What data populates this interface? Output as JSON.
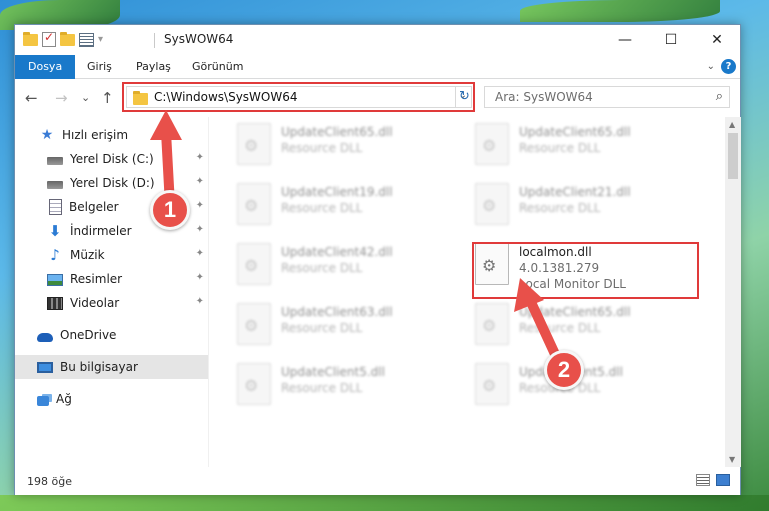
{
  "window": {
    "title": "SysWOW64",
    "controls": {
      "minimize": "—",
      "maximize": "☐",
      "close": "✕"
    }
  },
  "ribbon": {
    "tabs": [
      "Dosya",
      "Giriş",
      "Paylaş",
      "Görünüm"
    ],
    "expand_glyph": "⌄",
    "help_glyph": "?"
  },
  "nav": {
    "back": "←",
    "forward": "→",
    "recent": "⌄",
    "up": "↑",
    "address": "C:\\Windows\\SysWOW64",
    "address_dropdown": "⌄",
    "refresh": "↻",
    "search_placeholder": "Ara: SysWOW64",
    "search_icon": "⌕"
  },
  "sidebar": {
    "items": [
      {
        "label": "Hızlı erişim",
        "icon": "star-icon",
        "pinned": false
      },
      {
        "label": "Yerel Disk (C:)",
        "icon": "drive-icon",
        "pinned": true
      },
      {
        "label": "Yerel Disk (D:)",
        "icon": "drive-icon",
        "pinned": true
      },
      {
        "label": "Belgeler",
        "icon": "documents-icon",
        "pinned": true
      },
      {
        "label": "İndirmeler",
        "icon": "downloads-icon",
        "pinned": true
      },
      {
        "label": "Müzik",
        "icon": "music-icon",
        "pinned": true
      },
      {
        "label": "Resimler",
        "icon": "pictures-icon",
        "pinned": true
      },
      {
        "label": "Videolar",
        "icon": "videos-icon",
        "pinned": true
      },
      {
        "label": "OneDrive",
        "icon": "onedrive-icon",
        "pinned": false
      },
      {
        "label": "Bu bilgisayar",
        "icon": "this-pc-icon",
        "pinned": false
      },
      {
        "label": "Ağ",
        "icon": "network-icon",
        "pinned": false
      }
    ],
    "pin_glyph": "📌"
  },
  "files": [
    {
      "name": "UpdateClient65.dll",
      "desc": "Resource DLL"
    },
    {
      "name": "UpdateClient65.dll",
      "desc": "Resource DLL"
    },
    {
      "name": "UpdateClient19.dll",
      "desc": "Resource DLL"
    },
    {
      "name": "UpdateClient21.dll",
      "desc": "Resource DLL"
    },
    {
      "name": "UpdateClient42.dll",
      "desc": "Resource DLL"
    },
    {
      "name": "localmon.dll",
      "version": "4.0.1381.279",
      "desc": "Local Monitor DLL"
    },
    {
      "name": "UpdateClient63.dll",
      "desc": "Resource DLL"
    },
    {
      "name": "UpdateClient65.dll",
      "desc": "Resource DLL"
    },
    {
      "name": "UpdateClient5.dll",
      "desc": "Resource DLL"
    },
    {
      "name": "UpdateClient5.dll",
      "desc": "Resource DLL"
    }
  ],
  "status": {
    "count": "198 öğe"
  },
  "annotations": {
    "step1": "1",
    "step2": "2",
    "color": "#e03a3a"
  }
}
